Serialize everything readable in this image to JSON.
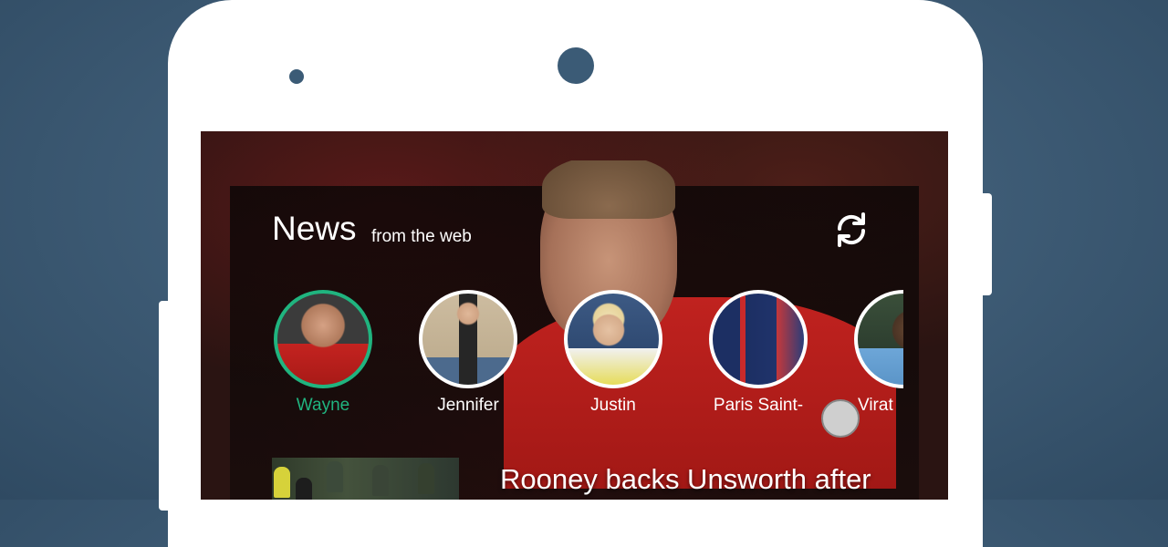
{
  "header": {
    "title": "News",
    "subtitle": "from the web",
    "refresh_icon": "refresh-icon"
  },
  "people": [
    {
      "name": "Wayne",
      "active": true
    },
    {
      "name": "Jennifer",
      "active": false
    },
    {
      "name": "Justin",
      "active": false
    },
    {
      "name": "Paris Saint-",
      "active": false
    },
    {
      "name": "Virat",
      "active": false
    }
  ],
  "article": {
    "headline": "Rooney backs Unsworth after"
  },
  "colors": {
    "accent": "#20b47f",
    "background": "#3f5d77",
    "phone_body": "#ffffff"
  }
}
